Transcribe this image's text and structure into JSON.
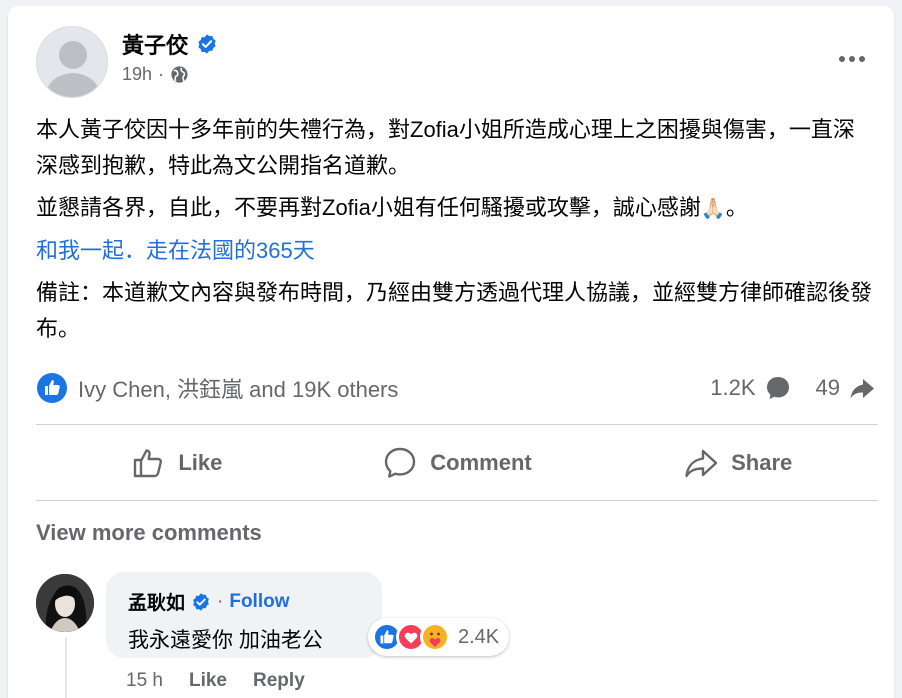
{
  "post": {
    "author": "黃子佼",
    "time": "19h",
    "separator": "·",
    "paragraph1": "本人黃子佼因十多年前的失禮行為，對Zofia小姐所造成心理上之困擾與傷害，一直深深感到抱歉，特此為文公開指名道歉。",
    "paragraph2": "並懇請各界，自此，不要再對Zofia小姐有任何騷擾或攻擊，誠心感謝",
    "emoji": "🙏🏻",
    "paragraph2_end": "。",
    "link": "和我一起．走在法國的365天",
    "paragraph4": "備註：本道歉文內容與發布時間，乃經由雙方透過代理人協議，並經雙方律師確認後發布。"
  },
  "stats": {
    "reactors": "Ivy Chen, 洪鈺嵐 and 19K others",
    "comments_count": "1.2K",
    "shares_count": "49"
  },
  "actions": {
    "like": "Like",
    "comment": "Comment",
    "share": "Share"
  },
  "comments": {
    "view_more": "View more comments",
    "first": {
      "name": "孟耿如",
      "separator": "·",
      "follow": "Follow",
      "text": "我永遠愛你 加油老公",
      "reaction_count": "2.4K",
      "time": "15 h",
      "like": "Like",
      "reply": "Reply"
    }
  },
  "colors": {
    "accent": "#216fdb",
    "like_blue": "#1b74e4",
    "love_red": "#f33e58",
    "care_yellow": "#f7b125",
    "secondary_text": "#65676b"
  },
  "icons": [
    "verified-badge-icon",
    "globe-icon",
    "more-options-icon",
    "like-reaction-icon",
    "comment-bubble-icon",
    "share-arrow-icon",
    "thumbs-up-icon",
    "love-reaction-icon",
    "care-reaction-icon"
  ]
}
